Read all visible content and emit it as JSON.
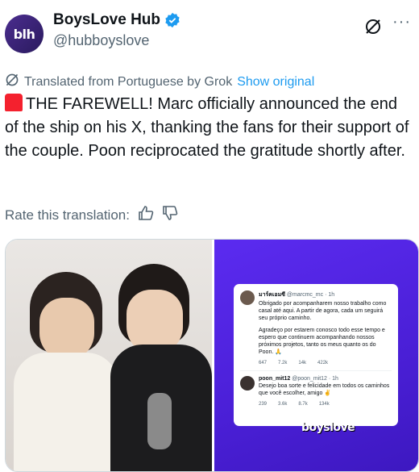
{
  "author": {
    "display_name": "BoysLove Hub",
    "handle": "@hubboyslove",
    "avatar_text": "blh"
  },
  "translation": {
    "note": "Translated from Portuguese by Grok",
    "show_original": "Show original"
  },
  "tweet": {
    "text": "THE FAREWELL! Marc officially announced the end of the ship on his X, thanking the fans for their support of the couple. Poon reciprocated the gratitude shortly after."
  },
  "rate": {
    "label": "Rate this translation:"
  },
  "media": {
    "post1": {
      "name": "มาร์คเอมซี",
      "handle": "@marcmc_mc · 1h",
      "text1": "Obrigado por acompanharem nosso trabalho como casal até aqui. A partir de agora, cada um seguirá seu próprio caminho.",
      "text2": "Agradeço por estarem conosco todo esse tempo e espero que continuem acompanhando nossos próximos projetos, tanto os meus quanto os do Poon. 🙏",
      "replies": "647",
      "reposts": "7.2k",
      "likes": "14k",
      "views": "422k"
    },
    "post2": {
      "name": "poon_mit12",
      "handle": "@poon_mit12 · 1h",
      "text": "Desejo boa sorte e felicidade em todos os caminhos que você escolher, amigo ✌",
      "replies": "239",
      "reposts": "3.6k",
      "likes": "8.7k",
      "views": "134k"
    },
    "watermark": "boyslove"
  },
  "colors": {
    "link": "#1d9bf0",
    "secondary_text": "#536471",
    "media_bg": "#4a1fd6"
  }
}
